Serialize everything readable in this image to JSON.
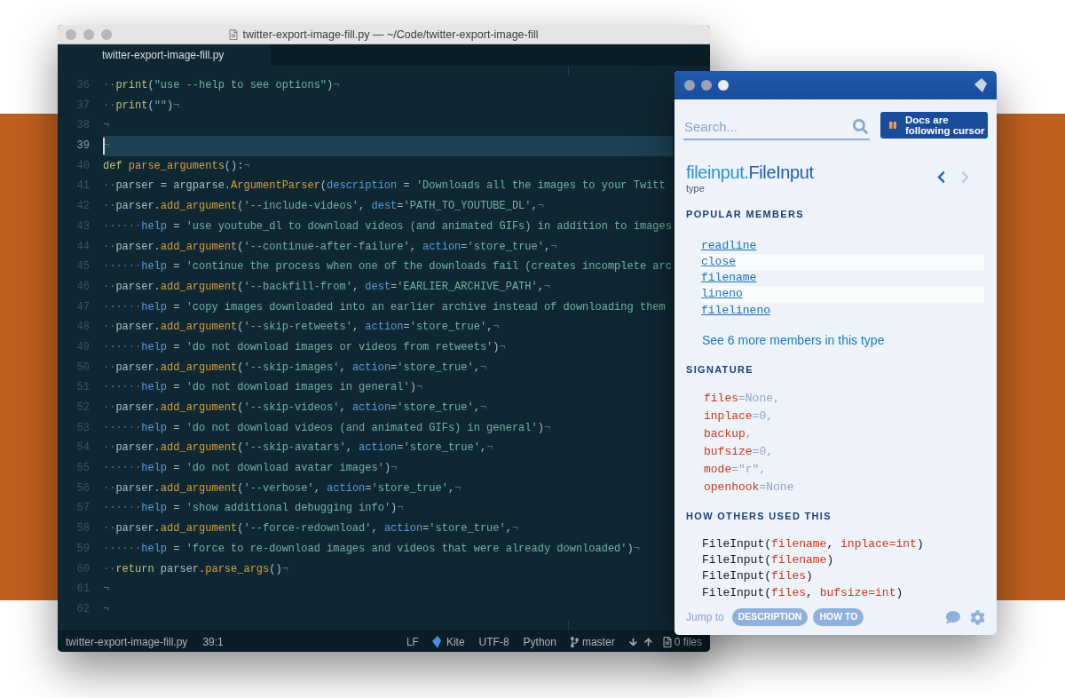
{
  "editor": {
    "title": "twitter-export-image-fill.py — ~/Code/twitter-export-image-fill",
    "tabs": [
      {
        "label": "twitter-export-image-fill.py",
        "selected": true
      }
    ],
    "lines": [
      {
        "number": "36",
        "current": false,
        "tokens": [
          {
            "kind": "ws",
            "text": "··"
          },
          {
            "kind": "kw",
            "text": "print"
          },
          {
            "kind": "p",
            "text": "("
          },
          {
            "kind": "s",
            "text": "\"use --help to see options\""
          },
          {
            "kind": "p",
            "text": ")"
          },
          {
            "kind": "ws",
            "text": "¬"
          }
        ]
      },
      {
        "number": "37",
        "current": false,
        "tokens": [
          {
            "kind": "ws",
            "text": "··"
          },
          {
            "kind": "kw",
            "text": "print"
          },
          {
            "kind": "p",
            "text": "("
          },
          {
            "kind": "s",
            "text": "\"\""
          },
          {
            "kind": "p",
            "text": ")"
          },
          {
            "kind": "ws",
            "text": "¬"
          }
        ]
      },
      {
        "number": "38",
        "current": false,
        "tokens": [
          {
            "kind": "ws",
            "text": "¬"
          }
        ]
      },
      {
        "number": "39",
        "current": true,
        "tokens": [
          {
            "kind": "ws",
            "text": "¬"
          }
        ]
      },
      {
        "number": "40",
        "current": false,
        "tokens": [
          {
            "kind": "kw",
            "text": "def "
          },
          {
            "kind": "fn",
            "text": "parse_arguments"
          },
          {
            "kind": "p",
            "text": "():"
          },
          {
            "kind": "ws",
            "text": "¬"
          }
        ]
      },
      {
        "number": "41",
        "current": false,
        "tokens": [
          {
            "kind": "ws",
            "text": "··"
          },
          {
            "kind": "p",
            "text": "parser = argparse."
          },
          {
            "kind": "fn",
            "text": "ArgumentParser"
          },
          {
            "kind": "p",
            "text": "("
          },
          {
            "kind": "a",
            "text": "description"
          },
          {
            "kind": "p",
            "text": " = "
          },
          {
            "kind": "s",
            "text": "'Downloads all the images to your Twitt"
          }
        ]
      },
      {
        "number": "42",
        "current": false,
        "tokens": [
          {
            "kind": "ws",
            "text": "··"
          },
          {
            "kind": "p",
            "text": "parser."
          },
          {
            "kind": "fn",
            "text": "add_argument"
          },
          {
            "kind": "p",
            "text": "("
          },
          {
            "kind": "s",
            "text": "'--include-videos'"
          },
          {
            "kind": "p",
            "text": ", "
          },
          {
            "kind": "a",
            "text": "dest"
          },
          {
            "kind": "p",
            "text": "="
          },
          {
            "kind": "s",
            "text": "'PATH_TO_YOUTUBE_DL'"
          },
          {
            "kind": "p",
            "text": ","
          },
          {
            "kind": "ws",
            "text": "¬"
          }
        ]
      },
      {
        "number": "43",
        "current": false,
        "tokens": [
          {
            "kind": "ws",
            "text": "······"
          },
          {
            "kind": "a",
            "text": "help"
          },
          {
            "kind": "p",
            "text": " = "
          },
          {
            "kind": "s",
            "text": "'use youtube_dl to download videos (and animated GIFs) in addition to images"
          }
        ]
      },
      {
        "number": "44",
        "current": false,
        "tokens": [
          {
            "kind": "ws",
            "text": "··"
          },
          {
            "kind": "p",
            "text": "parser."
          },
          {
            "kind": "fn",
            "text": "add_argument"
          },
          {
            "kind": "p",
            "text": "("
          },
          {
            "kind": "s",
            "text": "'--continue-after-failure'"
          },
          {
            "kind": "p",
            "text": ", "
          },
          {
            "kind": "a",
            "text": "action"
          },
          {
            "kind": "p",
            "text": "="
          },
          {
            "kind": "s",
            "text": "'store_true'"
          },
          {
            "kind": "p",
            "text": ","
          },
          {
            "kind": "ws",
            "text": "¬"
          }
        ]
      },
      {
        "number": "45",
        "current": false,
        "tokens": [
          {
            "kind": "ws",
            "text": "······"
          },
          {
            "kind": "a",
            "text": "help"
          },
          {
            "kind": "p",
            "text": " = "
          },
          {
            "kind": "s",
            "text": "'continue the process when one of the downloads fail (creates incomplete arc"
          }
        ]
      },
      {
        "number": "46",
        "current": false,
        "tokens": [
          {
            "kind": "ws",
            "text": "··"
          },
          {
            "kind": "p",
            "text": "parser."
          },
          {
            "kind": "fn",
            "text": "add_argument"
          },
          {
            "kind": "p",
            "text": "("
          },
          {
            "kind": "s",
            "text": "'--backfill-from'"
          },
          {
            "kind": "p",
            "text": ", "
          },
          {
            "kind": "a",
            "text": "dest"
          },
          {
            "kind": "p",
            "text": "="
          },
          {
            "kind": "s",
            "text": "'EARLIER_ARCHIVE_PATH'"
          },
          {
            "kind": "p",
            "text": ","
          },
          {
            "kind": "ws",
            "text": "¬"
          }
        ]
      },
      {
        "number": "47",
        "current": false,
        "tokens": [
          {
            "kind": "ws",
            "text": "······"
          },
          {
            "kind": "a",
            "text": "help"
          },
          {
            "kind": "p",
            "text": " = "
          },
          {
            "kind": "s",
            "text": "'copy images downloaded into an earlier archive instead of downloading them"
          }
        ]
      },
      {
        "number": "48",
        "current": false,
        "tokens": [
          {
            "kind": "ws",
            "text": "··"
          },
          {
            "kind": "p",
            "text": "parser."
          },
          {
            "kind": "fn",
            "text": "add_argument"
          },
          {
            "kind": "p",
            "text": "("
          },
          {
            "kind": "s",
            "text": "'--skip-retweets'"
          },
          {
            "kind": "p",
            "text": ", "
          },
          {
            "kind": "a",
            "text": "action"
          },
          {
            "kind": "p",
            "text": "="
          },
          {
            "kind": "s",
            "text": "'store_true'"
          },
          {
            "kind": "p",
            "text": ","
          },
          {
            "kind": "ws",
            "text": "¬"
          }
        ]
      },
      {
        "number": "49",
        "current": false,
        "tokens": [
          {
            "kind": "ws",
            "text": "······"
          },
          {
            "kind": "a",
            "text": "help"
          },
          {
            "kind": "p",
            "text": " = "
          },
          {
            "kind": "s",
            "text": "'do not download images or videos from retweets'"
          },
          {
            "kind": "p",
            "text": ")"
          },
          {
            "kind": "ws",
            "text": "¬"
          }
        ]
      },
      {
        "number": "50",
        "current": false,
        "tokens": [
          {
            "kind": "ws",
            "text": "··"
          },
          {
            "kind": "p",
            "text": "parser."
          },
          {
            "kind": "fn",
            "text": "add_argument"
          },
          {
            "kind": "p",
            "text": "("
          },
          {
            "kind": "s",
            "text": "'--skip-images'"
          },
          {
            "kind": "p",
            "text": ", "
          },
          {
            "kind": "a",
            "text": "action"
          },
          {
            "kind": "p",
            "text": "="
          },
          {
            "kind": "s",
            "text": "'store_true'"
          },
          {
            "kind": "p",
            "text": ","
          },
          {
            "kind": "ws",
            "text": "¬"
          }
        ]
      },
      {
        "number": "51",
        "current": false,
        "tokens": [
          {
            "kind": "ws",
            "text": "······"
          },
          {
            "kind": "a",
            "text": "help"
          },
          {
            "kind": "p",
            "text": " = "
          },
          {
            "kind": "s",
            "text": "'do not download images in general'"
          },
          {
            "kind": "p",
            "text": ")"
          },
          {
            "kind": "ws",
            "text": "¬"
          }
        ]
      },
      {
        "number": "52",
        "current": false,
        "tokens": [
          {
            "kind": "ws",
            "text": "··"
          },
          {
            "kind": "p",
            "text": "parser."
          },
          {
            "kind": "fn",
            "text": "add_argument"
          },
          {
            "kind": "p",
            "text": "("
          },
          {
            "kind": "s",
            "text": "'--skip-videos'"
          },
          {
            "kind": "p",
            "text": ", "
          },
          {
            "kind": "a",
            "text": "action"
          },
          {
            "kind": "p",
            "text": "="
          },
          {
            "kind": "s",
            "text": "'store_true'"
          },
          {
            "kind": "p",
            "text": ","
          },
          {
            "kind": "ws",
            "text": "¬"
          }
        ]
      },
      {
        "number": "53",
        "current": false,
        "tokens": [
          {
            "kind": "ws",
            "text": "······"
          },
          {
            "kind": "a",
            "text": "help"
          },
          {
            "kind": "p",
            "text": " = "
          },
          {
            "kind": "s",
            "text": "'do not download videos (and animated GIFs) in general'"
          },
          {
            "kind": "p",
            "text": ")"
          },
          {
            "kind": "ws",
            "text": "¬"
          }
        ]
      },
      {
        "number": "54",
        "current": false,
        "tokens": [
          {
            "kind": "ws",
            "text": "··"
          },
          {
            "kind": "p",
            "text": "parser."
          },
          {
            "kind": "fn",
            "text": "add_argument"
          },
          {
            "kind": "p",
            "text": "("
          },
          {
            "kind": "s",
            "text": "'--skip-avatars'"
          },
          {
            "kind": "p",
            "text": ", "
          },
          {
            "kind": "a",
            "text": "action"
          },
          {
            "kind": "p",
            "text": "="
          },
          {
            "kind": "s",
            "text": "'store_true'"
          },
          {
            "kind": "p",
            "text": ","
          },
          {
            "kind": "ws",
            "text": "¬"
          }
        ]
      },
      {
        "number": "55",
        "current": false,
        "tokens": [
          {
            "kind": "ws",
            "text": "······"
          },
          {
            "kind": "a",
            "text": "help"
          },
          {
            "kind": "p",
            "text": " = "
          },
          {
            "kind": "s",
            "text": "'do not download avatar images'"
          },
          {
            "kind": "p",
            "text": ")"
          },
          {
            "kind": "ws",
            "text": "¬"
          }
        ]
      },
      {
        "number": "56",
        "current": false,
        "tokens": [
          {
            "kind": "ws",
            "text": "··"
          },
          {
            "kind": "p",
            "text": "parser."
          },
          {
            "kind": "fn",
            "text": "add_argument"
          },
          {
            "kind": "p",
            "text": "("
          },
          {
            "kind": "s",
            "text": "'--verbose'"
          },
          {
            "kind": "p",
            "text": ", "
          },
          {
            "kind": "a",
            "text": "action"
          },
          {
            "kind": "p",
            "text": "="
          },
          {
            "kind": "s",
            "text": "'store_true'"
          },
          {
            "kind": "p",
            "text": ","
          },
          {
            "kind": "ws",
            "text": "¬"
          }
        ]
      },
      {
        "number": "57",
        "current": false,
        "tokens": [
          {
            "kind": "ws",
            "text": "······"
          },
          {
            "kind": "a",
            "text": "help"
          },
          {
            "kind": "p",
            "text": " = "
          },
          {
            "kind": "s",
            "text": "'show additional debugging info'"
          },
          {
            "kind": "p",
            "text": ")"
          },
          {
            "kind": "ws",
            "text": "¬"
          }
        ]
      },
      {
        "number": "58",
        "current": false,
        "tokens": [
          {
            "kind": "ws",
            "text": "··"
          },
          {
            "kind": "p",
            "text": "parser."
          },
          {
            "kind": "fn",
            "text": "add_argument"
          },
          {
            "kind": "p",
            "text": "("
          },
          {
            "kind": "s",
            "text": "'--force-redownload'"
          },
          {
            "kind": "p",
            "text": ", "
          },
          {
            "kind": "a",
            "text": "action"
          },
          {
            "kind": "p",
            "text": "="
          },
          {
            "kind": "s",
            "text": "'store_true'"
          },
          {
            "kind": "p",
            "text": ","
          },
          {
            "kind": "ws",
            "text": "¬"
          }
        ]
      },
      {
        "number": "59",
        "current": false,
        "tokens": [
          {
            "kind": "ws",
            "text": "······"
          },
          {
            "kind": "a",
            "text": "help"
          },
          {
            "kind": "p",
            "text": " = "
          },
          {
            "kind": "s",
            "text": "'force to re-download images and videos that were already downloaded'"
          },
          {
            "kind": "p",
            "text": ")"
          },
          {
            "kind": "ws",
            "text": "¬"
          }
        ]
      },
      {
        "number": "60",
        "current": false,
        "tokens": [
          {
            "kind": "ws",
            "text": "··"
          },
          {
            "kind": "kw",
            "text": "return"
          },
          {
            "kind": "p",
            "text": " parser."
          },
          {
            "kind": "fn",
            "text": "parse_args"
          },
          {
            "kind": "p",
            "text": "()"
          },
          {
            "kind": "ws",
            "text": "¬"
          }
        ]
      },
      {
        "number": "61",
        "current": false,
        "tokens": [
          {
            "kind": "ws",
            "text": "¬"
          }
        ]
      },
      {
        "number": "62",
        "current": false,
        "tokens": [
          {
            "kind": "ws",
            "text": "¬"
          }
        ]
      }
    ],
    "status_bar": {
      "file": "twitter-export-image-fill.py",
      "position": "39:1",
      "line_ending": "LF",
      "kite": "Kite",
      "encoding": "UTF-8",
      "grammar": "Python",
      "branch": "master",
      "files": "0 files"
    }
  },
  "kite": {
    "search": {
      "placeholder": "Search..."
    },
    "follow_button": "Docs are following cursor",
    "title": {
      "module": "fileinput.",
      "name": "FileInput"
    },
    "kind": "type",
    "nav": {
      "back": {
        "disabled": false
      },
      "forward": {
        "disabled": true
      }
    },
    "popular_members": {
      "heading": "POPULAR MEMBERS",
      "items": [
        "readline",
        "close",
        "filename",
        "lineno",
        "filelineno"
      ],
      "more": "See 6 more members in this type"
    },
    "signature": {
      "heading": "SIGNATURE",
      "params": [
        {
          "name": "files",
          "rest": "=None,"
        },
        {
          "name": "inplace",
          "rest": "=0,"
        },
        {
          "name": "backup",
          "rest": ","
        },
        {
          "name": "bufsize",
          "rest": "=0,"
        },
        {
          "name": "mode",
          "rest": "=\"r\","
        },
        {
          "name": "openhook",
          "rest": "=None"
        }
      ]
    },
    "usages": {
      "heading": "HOW OTHERS USED THIS",
      "lines": [
        [
          {
            "kind": "p",
            "text": "FileInput("
          },
          {
            "kind": "arg",
            "text": "filename"
          },
          {
            "kind": "p",
            "text": ", "
          },
          {
            "kind": "arg",
            "text": "inplace=int"
          },
          {
            "kind": "p",
            "text": ")"
          }
        ],
        [
          {
            "kind": "p",
            "text": "FileInput("
          },
          {
            "kind": "arg",
            "text": "filename"
          },
          {
            "kind": "p",
            "text": ")"
          }
        ],
        [
          {
            "kind": "p",
            "text": "FileInput("
          },
          {
            "kind": "arg",
            "text": "files"
          },
          {
            "kind": "p",
            "text": ")"
          }
        ],
        [
          {
            "kind": "p",
            "text": "FileInput("
          },
          {
            "kind": "arg",
            "text": "files"
          },
          {
            "kind": "p",
            "text": ", "
          },
          {
            "kind": "arg",
            "text": "bufsize=int"
          },
          {
            "kind": "p",
            "text": ")"
          }
        ]
      ]
    },
    "footer": {
      "jump_label": "Jump to",
      "links": [
        "DESCRIPTION",
        "HOW TO"
      ]
    }
  }
}
